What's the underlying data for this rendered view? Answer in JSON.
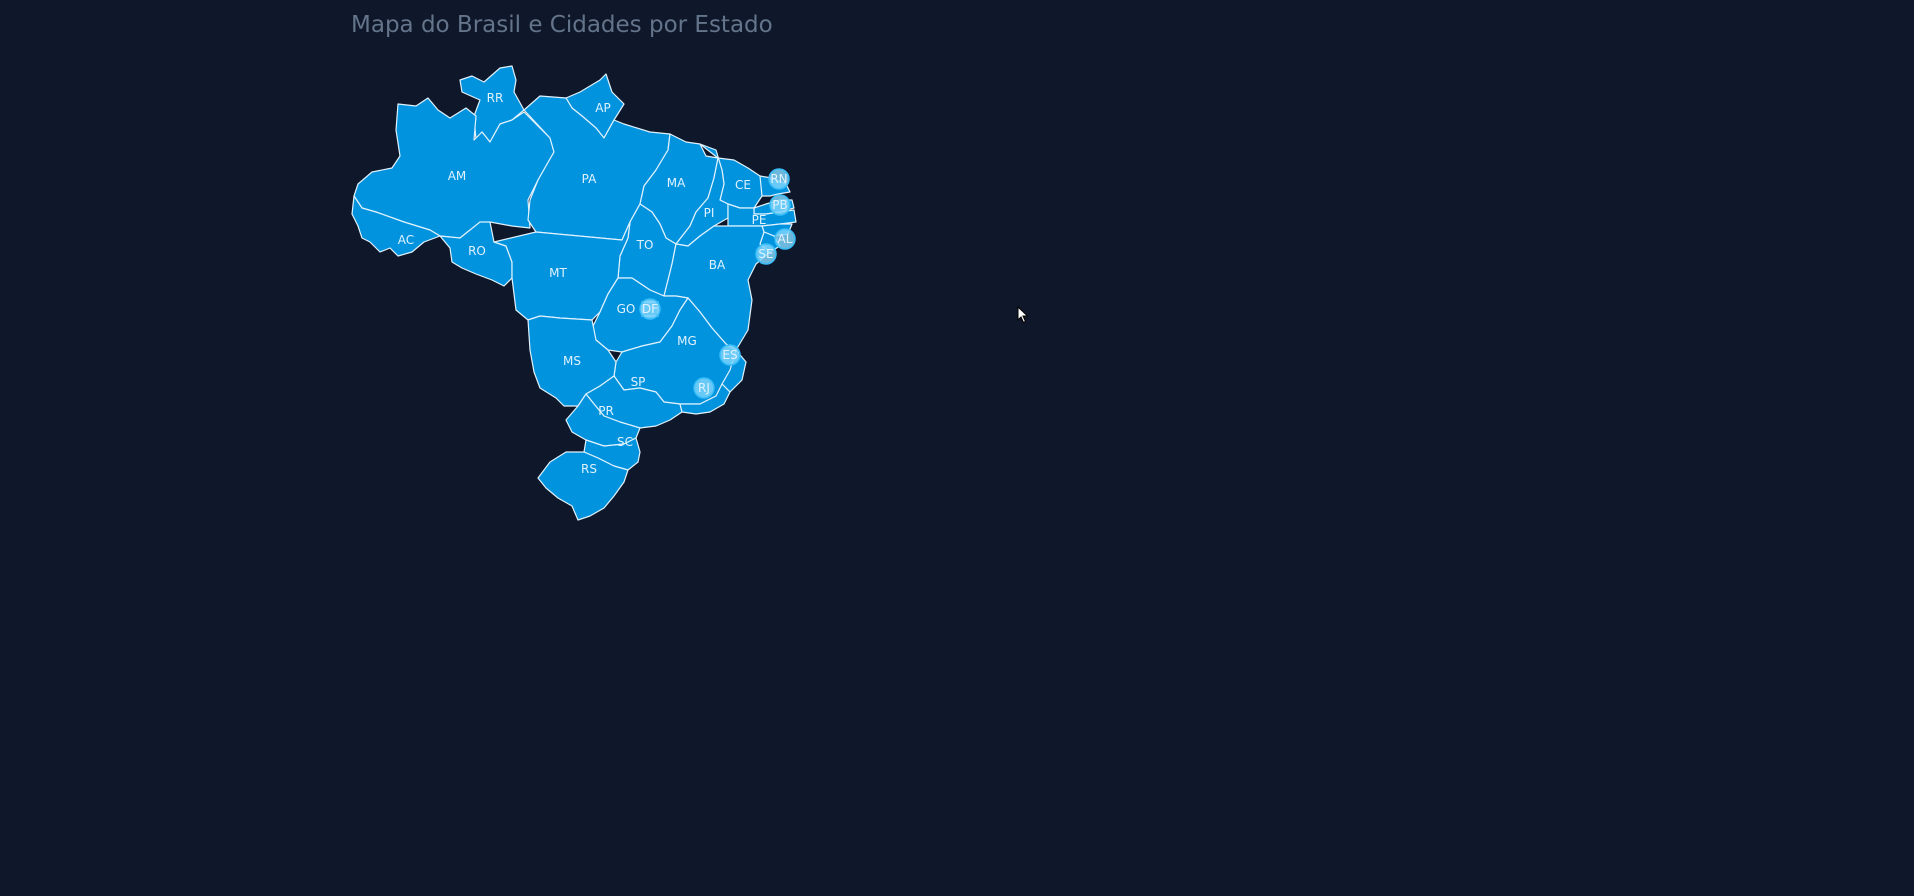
{
  "page": {
    "title": "Mapa do Brasil e Cidades por Estado"
  },
  "map": {
    "fill_color": "#0293de",
    "border_color": "#e0f2fe",
    "background": "#0f172a",
    "marker_color": "#7dd3fc",
    "states": [
      {
        "id": "RR",
        "label": "RR",
        "marker": false
      },
      {
        "id": "AP",
        "label": "AP",
        "marker": false
      },
      {
        "id": "AM",
        "label": "AM",
        "marker": false
      },
      {
        "id": "PA",
        "label": "PA",
        "marker": false
      },
      {
        "id": "MA",
        "label": "MA",
        "marker": false
      },
      {
        "id": "CE",
        "label": "CE",
        "marker": false
      },
      {
        "id": "RN",
        "label": "RN",
        "marker": true
      },
      {
        "id": "PB",
        "label": "PB",
        "marker": true
      },
      {
        "id": "PI",
        "label": "PI",
        "marker": false
      },
      {
        "id": "PE",
        "label": "PE",
        "marker": false
      },
      {
        "id": "AL",
        "label": "AL",
        "marker": true
      },
      {
        "id": "SE",
        "label": "SE",
        "marker": true
      },
      {
        "id": "AC",
        "label": "AC",
        "marker": false
      },
      {
        "id": "RO",
        "label": "RO",
        "marker": false
      },
      {
        "id": "TO",
        "label": "TO",
        "marker": false
      },
      {
        "id": "BA",
        "label": "BA",
        "marker": false
      },
      {
        "id": "MT",
        "label": "MT",
        "marker": false
      },
      {
        "id": "GO",
        "label": "GO",
        "marker": false
      },
      {
        "id": "DF",
        "label": "DF",
        "marker": true
      },
      {
        "id": "MG",
        "label": "MG",
        "marker": false
      },
      {
        "id": "ES",
        "label": "ES",
        "marker": true
      },
      {
        "id": "MS",
        "label": "MS",
        "marker": false
      },
      {
        "id": "SP",
        "label": "SP",
        "marker": false
      },
      {
        "id": "RJ",
        "label": "RJ",
        "marker": true
      },
      {
        "id": "PR",
        "label": "PR",
        "marker": false
      },
      {
        "id": "SC",
        "label": "SC",
        "marker": false
      },
      {
        "id": "RS",
        "label": "RS",
        "marker": false
      }
    ]
  },
  "cursor": {
    "icon": "pointer-arrow-icon"
  }
}
